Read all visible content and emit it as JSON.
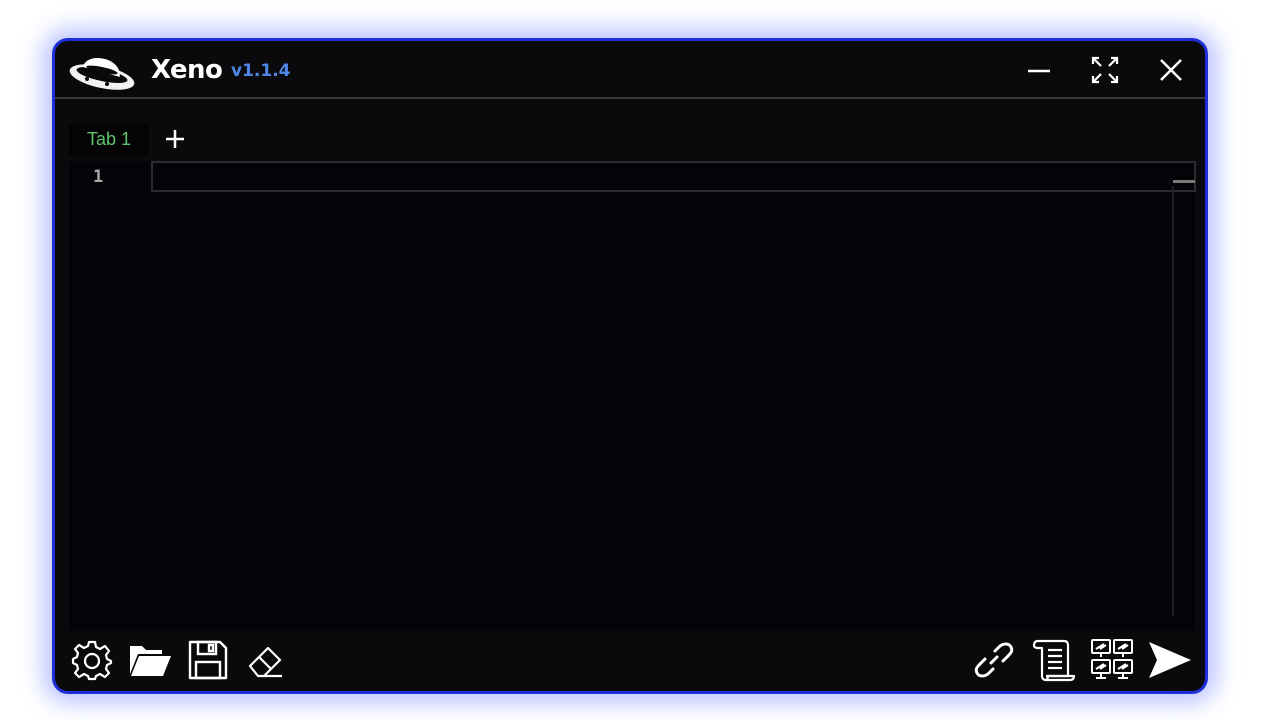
{
  "app": {
    "name": "Xeno",
    "version": "v1.1.4",
    "logo_icon": "ufo-icon"
  },
  "window_controls": {
    "minimize_icon": "minimize-icon",
    "maximize_icon": "expand-icon",
    "close_icon": "close-icon"
  },
  "tabs": {
    "items": [
      {
        "label": "Tab 1",
        "active": true
      }
    ],
    "add_icon": "plus-icon"
  },
  "editor": {
    "line_numbers": [
      "1"
    ],
    "content": ""
  },
  "toolbar": {
    "left": [
      "settings-icon",
      "open-folder-icon",
      "save-icon",
      "eraser-icon"
    ],
    "right": [
      "link-icon",
      "script-icon",
      "multi-client-icon",
      "execute-icon"
    ]
  },
  "colors": {
    "border_accent": "#1f2fd8",
    "version_text": "#4f86e8",
    "tab_text": "#5fc46a",
    "background": "#0a0a0c",
    "editor_background": "#040308"
  }
}
